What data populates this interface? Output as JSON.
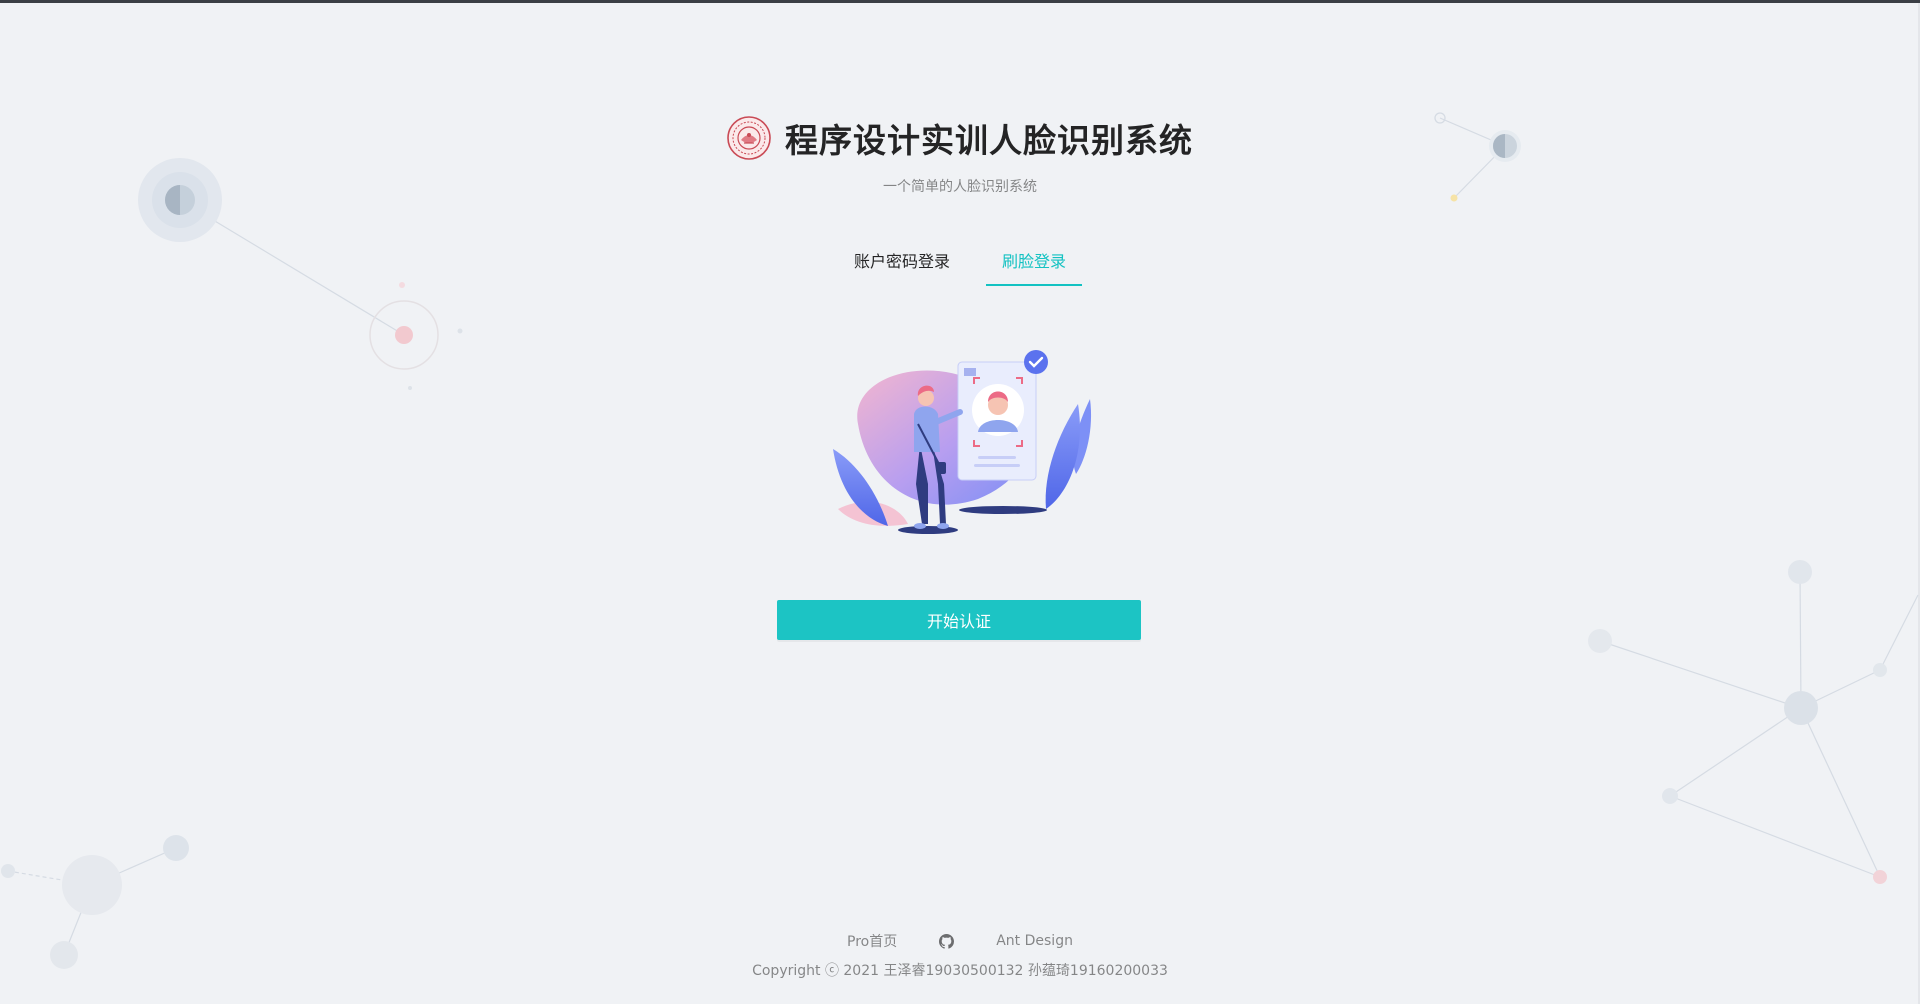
{
  "header": {
    "title": "程序设计实训人脸识别系统",
    "subtitle": "一个简单的人脸识别系统",
    "logo_icon": "university-seal-icon"
  },
  "tabs": [
    {
      "label": "账户密码登录",
      "active": false
    },
    {
      "label": "刷脸登录",
      "active": true
    }
  ],
  "illustration": {
    "icon": "face-recognition-illustration"
  },
  "actions": {
    "start_label": "开始认证"
  },
  "footer": {
    "links": [
      {
        "label": "Pro首页"
      },
      {
        "label": "",
        "icon": "github-icon"
      },
      {
        "label": "Ant Design"
      }
    ],
    "copyright": "Copyright ⓒ 2021 王泽睿19030500132 孙蕴琦19160200033"
  },
  "colors": {
    "accent": "#13c2c2",
    "button": "#1cc4c4",
    "background": "#f0f2f5",
    "illustration_blue": "#6a80f4",
    "illustration_pink": "#ee7a96"
  }
}
